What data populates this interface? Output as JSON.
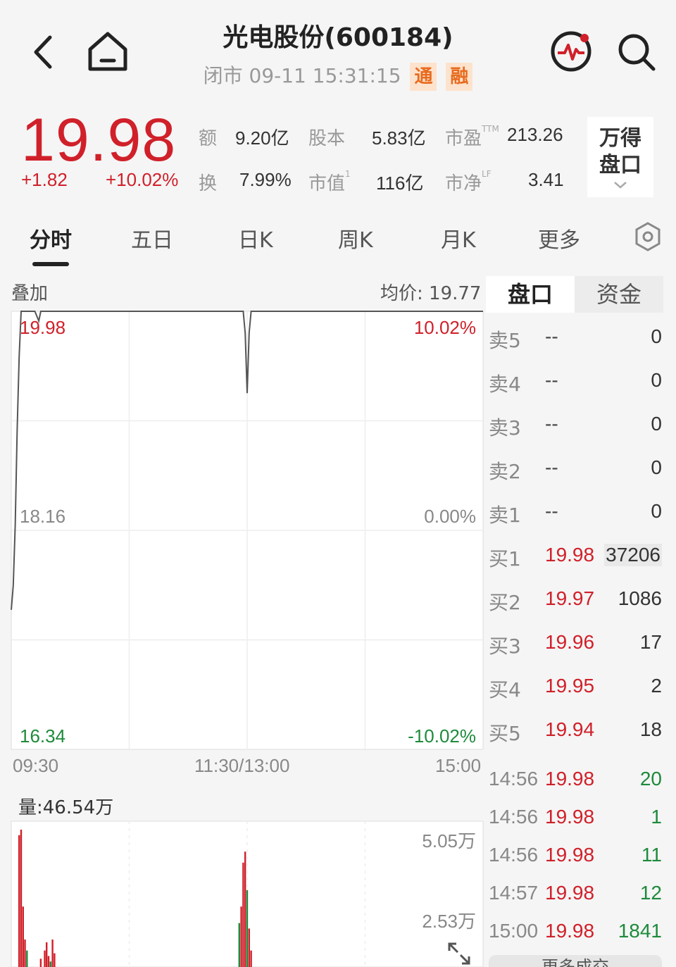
{
  "header": {
    "title": "光电股份(600184)",
    "status": "闭市 09-11 15:31:15",
    "badge_tong": "通",
    "badge_rong": "融"
  },
  "quote": {
    "price": "19.98",
    "change": "+1.82",
    "change_pct": "+10.02%",
    "stats": [
      {
        "label": "额",
        "value": "9.20亿"
      },
      {
        "label": "股本",
        "value": "5.83亿"
      },
      {
        "label": "市盈",
        "sup": "TTM",
        "value": "213.26"
      },
      {
        "label": "换",
        "value": "7.99%"
      },
      {
        "label": "市值",
        "sup": "1",
        "value": "116亿"
      },
      {
        "label": "市净",
        "sup": "LF",
        "value": "3.41"
      }
    ],
    "wind_line1": "万得",
    "wind_line2": "盘口"
  },
  "tabs": [
    "分时",
    "五日",
    "日K",
    "周K",
    "月K",
    "更多"
  ],
  "chart": {
    "overlay": "叠加",
    "avg_price": "均价: 19.77",
    "y_top": "19.98",
    "y_mid": "18.16",
    "y_bot": "16.34",
    "pct_top": "10.02%",
    "pct_mid": "0.00%",
    "pct_bot": "-10.02%",
    "times": [
      "09:30",
      "11:30/13:00",
      "15:00"
    ],
    "volume_label": "量:46.54万",
    "vol_ticks": [
      "5.05万",
      "2.53万"
    ]
  },
  "chart_data": {
    "type": "line",
    "ylim": [
      16.34,
      19.98
    ],
    "price_points": [
      [
        0,
        17.5
      ],
      [
        1,
        17.7
      ],
      [
        2,
        18.2
      ],
      [
        3,
        19.0
      ],
      [
        4,
        19.6
      ],
      [
        5,
        19.98
      ],
      [
        12,
        19.98
      ],
      [
        14,
        19.9
      ],
      [
        15,
        19.98
      ],
      [
        100,
        19.98
      ],
      [
        118,
        19.98
      ],
      [
        119,
        19.8
      ],
      [
        120,
        19.3
      ],
      [
        121,
        19.8
      ],
      [
        122,
        19.98
      ],
      [
        240,
        19.98
      ]
    ],
    "volume_bars": [
      {
        "x": 4,
        "v": 4.8,
        "c": "red"
      },
      {
        "x": 5,
        "v": 5.0,
        "c": "red"
      },
      {
        "x": 6,
        "v": 2.2,
        "c": "red"
      },
      {
        "x": 7,
        "v": 1.0,
        "c": "red"
      },
      {
        "x": 8,
        "v": 0.6,
        "c": "green"
      },
      {
        "x": 15,
        "v": 0.3,
        "c": "red"
      },
      {
        "x": 17,
        "v": 0.6,
        "c": "red"
      },
      {
        "x": 18,
        "v": 0.9,
        "c": "red"
      },
      {
        "x": 19,
        "v": 0.4,
        "c": "red"
      },
      {
        "x": 20,
        "v": 0.2,
        "c": "green"
      },
      {
        "x": 21,
        "v": 1.0,
        "c": "red"
      },
      {
        "x": 22,
        "v": 0.5,
        "c": "red"
      },
      {
        "x": 116,
        "v": 1.6,
        "c": "green"
      },
      {
        "x": 117,
        "v": 2.2,
        "c": "red"
      },
      {
        "x": 118,
        "v": 3.8,
        "c": "red"
      },
      {
        "x": 119,
        "v": 4.2,
        "c": "red"
      },
      {
        "x": 120,
        "v": 2.8,
        "c": "green"
      },
      {
        "x": 121,
        "v": 1.4,
        "c": "red"
      },
      {
        "x": 122,
        "v": 0.6,
        "c": "red"
      }
    ]
  },
  "order_book": {
    "tabs": [
      "盘口",
      "资金"
    ],
    "asks": [
      {
        "label": "卖5",
        "price": "--",
        "qty": "0"
      },
      {
        "label": "卖4",
        "price": "--",
        "qty": "0"
      },
      {
        "label": "卖3",
        "price": "--",
        "qty": "0"
      },
      {
        "label": "卖2",
        "price": "--",
        "qty": "0"
      },
      {
        "label": "卖1",
        "price": "--",
        "qty": "0"
      }
    ],
    "bids": [
      {
        "label": "买1",
        "price": "19.98",
        "qty": "37206"
      },
      {
        "label": "买2",
        "price": "19.97",
        "qty": "1086"
      },
      {
        "label": "买3",
        "price": "19.96",
        "qty": "17"
      },
      {
        "label": "买4",
        "price": "19.95",
        "qty": "2"
      },
      {
        "label": "买5",
        "price": "19.94",
        "qty": "18"
      }
    ],
    "trades": [
      {
        "time": "14:56",
        "price": "19.98",
        "vol": "20"
      },
      {
        "time": "14:56",
        "price": "19.98",
        "vol": "1"
      },
      {
        "time": "14:56",
        "price": "19.98",
        "vol": "11"
      },
      {
        "time": "14:57",
        "price": "19.98",
        "vol": "12"
      },
      {
        "time": "15:00",
        "price": "19.98",
        "vol": "1841"
      }
    ],
    "more_trades": "更多成交"
  }
}
